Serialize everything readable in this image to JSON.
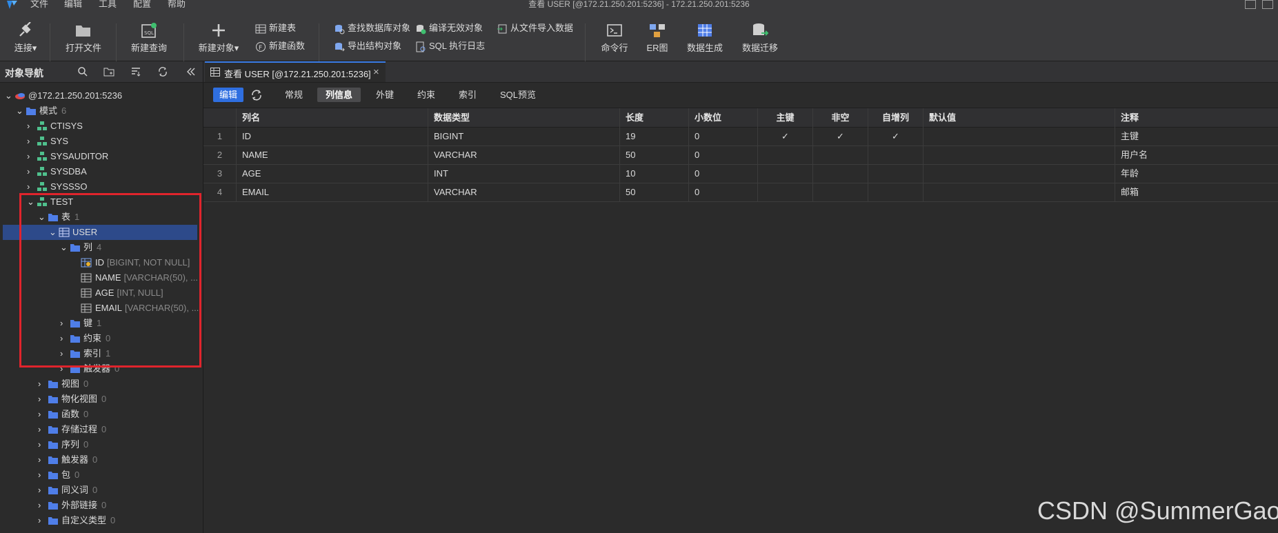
{
  "menubar": {
    "items": [
      "文件",
      "编辑",
      "工具",
      "配置",
      "帮助"
    ],
    "window_title": "查看 USER [@172.21.250.201:5236]  - 172.21.250.201:5236"
  },
  "toolbar": {
    "connect": "连接",
    "open_file": "打开文件",
    "new_query": "新建查询",
    "new_object": "新建对象",
    "new_table": "新建表",
    "new_function": "新建函数",
    "find_db_object": "查找数据库对象",
    "export_structure": "导出结构对象",
    "compile_invalid": "编译无效对象",
    "sql_log": "SQL 执行日志",
    "import_from_file": "从文件导入数据",
    "command_line": "命令行",
    "er_diagram": "ER图",
    "data_generation": "数据生成",
    "data_migration": "数据迁移"
  },
  "sidebar": {
    "title": "对象导航",
    "tree": {
      "connection": "@172.21.250.201:5236",
      "schema": {
        "label": "模式",
        "count": "6"
      },
      "schemas": [
        "CTISYS",
        "SYS",
        "SYSAUDITOR",
        "SYSDBA",
        "SYSSSO"
      ],
      "test": "TEST",
      "tables": {
        "label": "表",
        "count": "1"
      },
      "user_table": "USER",
      "columns": {
        "label": "列",
        "count": "4"
      },
      "column_nodes": [
        {
          "name": "ID",
          "meta": "[BIGINT, NOT NULL]"
        },
        {
          "name": "NAME",
          "meta": "[VARCHAR(50), ..."
        },
        {
          "name": "AGE",
          "meta": "[INT, NULL]"
        },
        {
          "name": "EMAIL",
          "meta": "[VARCHAR(50), ..."
        }
      ],
      "table_children": [
        {
          "label": "键",
          "count": "1"
        },
        {
          "label": "约束",
          "count": "0"
        },
        {
          "label": "索引",
          "count": "1"
        },
        {
          "label": "触发器",
          "count": "0"
        }
      ],
      "schema_children": [
        {
          "label": "视图",
          "count": "0"
        },
        {
          "label": "物化视图",
          "count": "0"
        },
        {
          "label": "函数",
          "count": "0"
        },
        {
          "label": "存储过程",
          "count": "0"
        },
        {
          "label": "序列",
          "count": "0"
        },
        {
          "label": "触发器",
          "count": "0"
        },
        {
          "label": "包",
          "count": "0"
        },
        {
          "label": "同义词",
          "count": "0"
        },
        {
          "label": "外部链接",
          "count": "0"
        },
        {
          "label": "自定义类型",
          "count": "0"
        }
      ]
    }
  },
  "tab": {
    "title": "查看 USER [@172.21.250.201:5236]",
    "close": "×"
  },
  "subtabs": {
    "edit": "编辑",
    "items": [
      "常规",
      "列信息",
      "外键",
      "约束",
      "索引",
      "SQL预览"
    ]
  },
  "table": {
    "headers": [
      "列名",
      "数据类型",
      "长度",
      "小数位",
      "主键",
      "非空",
      "自增列",
      "默认值",
      "注释"
    ],
    "rows": [
      [
        "1",
        "ID",
        "BIGINT",
        "19",
        "0",
        "✓",
        "✓",
        "✓",
        "",
        "主键"
      ],
      [
        "2",
        "NAME",
        "VARCHAR",
        "50",
        "0",
        "",
        "",
        "",
        "",
        "用户名"
      ],
      [
        "3",
        "AGE",
        "INT",
        "10",
        "0",
        "",
        "",
        "",
        "",
        "年龄"
      ],
      [
        "4",
        "EMAIL",
        "VARCHAR",
        "50",
        "0",
        "",
        "",
        "",
        "",
        "邮箱"
      ]
    ]
  },
  "watermark": "CSDN @SummerGao.",
  "colors": {
    "accent": "#2f6fe0",
    "highlight_box": "#e0242c",
    "selected_row": "#2d4a8a",
    "folder": "#4f7ee8",
    "schema_icon": "#4fc08d"
  }
}
